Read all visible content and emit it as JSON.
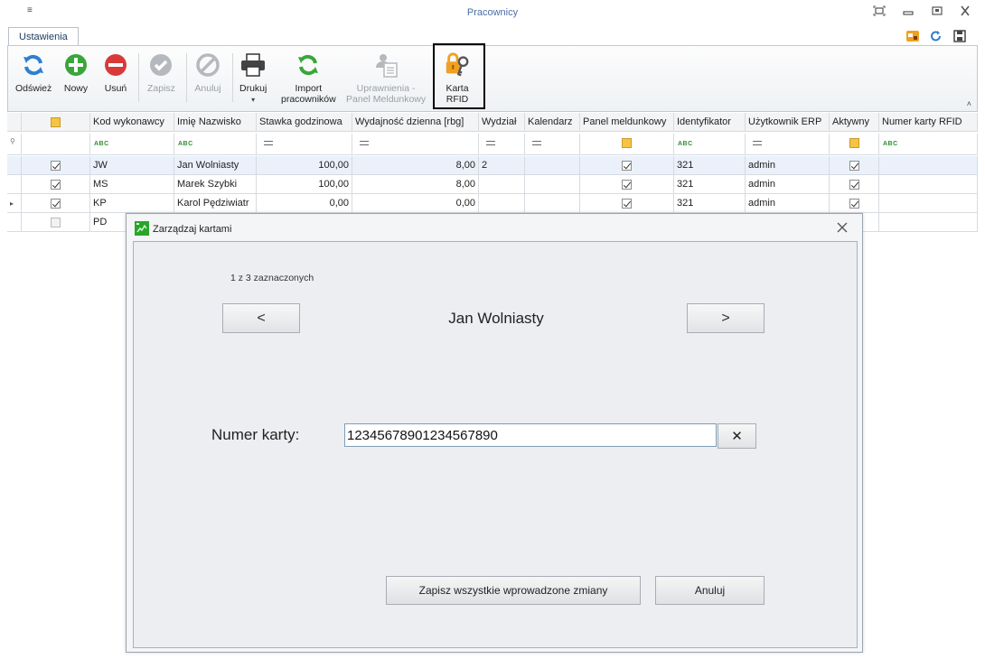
{
  "window": {
    "title": "Pracownicy",
    "qa_glyph": "≡"
  },
  "tabs": [
    {
      "label": "Ustawienia"
    }
  ],
  "ribbon": {
    "buttons": [
      {
        "label": "Odśwież",
        "icon": "refresh-icon",
        "enabled": true
      },
      {
        "label": "Nowy",
        "icon": "add-icon",
        "enabled": true
      },
      {
        "label": "Usuń",
        "icon": "delete-icon",
        "enabled": true
      },
      {
        "label": "Zapisz",
        "icon": "save-check-icon",
        "enabled": false
      },
      {
        "label": "Anuluj",
        "icon": "cancel-icon",
        "enabled": false
      },
      {
        "label": "Drukuj",
        "icon": "printer-icon",
        "enabled": true,
        "dropdown": "▾"
      },
      {
        "label_line1": "Import",
        "label_line2": "pracowników",
        "icon": "import-icon",
        "enabled": true
      },
      {
        "label_line1": "Uprawnienia -",
        "label_line2": "Panel Meldunkowy",
        "icon": "permissions-icon",
        "enabled": false
      },
      {
        "label_line1": "Karta",
        "label_line2": "RFID",
        "icon": "rfid-lock-key-icon",
        "enabled": true
      }
    ],
    "collapse_glyph": "˄"
  },
  "grid": {
    "columns": [
      "",
      "",
      "Kod wykonawcy",
      "Imię Nazwisko",
      "Stawka godzinowa",
      "Wydajność dzienna [rbg]",
      "Wydział",
      "Kalendarz",
      "Panel meldunkowy",
      "Identyfikator",
      "Użytkownik ERP",
      "Aktywny",
      "Numer karty RFID"
    ],
    "filter_abc": "ABC",
    "rows": [
      {
        "indicator": "",
        "checked": true,
        "code": "JW",
        "name": "Jan Wolniasty",
        "rate": "100,00",
        "efficiency": "8,00",
        "department": "2",
        "calendar": "",
        "panel": true,
        "identifier": "321",
        "erp_user": "admin",
        "active": true,
        "rfid": ""
      },
      {
        "indicator": "",
        "checked": true,
        "code": "MS",
        "name": "Marek Szybki",
        "rate": "100,00",
        "efficiency": "8,00",
        "department": "",
        "calendar": "",
        "panel": true,
        "identifier": "321",
        "erp_user": "admin",
        "active": true,
        "rfid": ""
      },
      {
        "indicator": "▸",
        "checked": true,
        "code": "KP",
        "name": "Karol Pędziwiatr",
        "rate": "0,00",
        "efficiency": "0,00",
        "department": "",
        "calendar": "",
        "panel": true,
        "identifier": "321",
        "erp_user": "admin",
        "active": true,
        "rfid": ""
      },
      {
        "indicator": "",
        "checked": false,
        "code": "PD",
        "name": "",
        "rate": "",
        "efficiency": "",
        "department": "",
        "calendar": "",
        "panel": false,
        "identifier": "",
        "erp_user": "",
        "active": false,
        "rfid": ""
      }
    ]
  },
  "dialog": {
    "title": "Zarządzaj kartami",
    "counter": "1 z 3 zaznaczonych",
    "prev_label": "<",
    "next_label": ">",
    "employee_name": "Jan Wolniasty",
    "card_label": "Numer karty:",
    "card_value": "12345678901234567890",
    "clear_label": "✕",
    "save_all_label": "Zapisz wszystkie wprowadzone zmiany",
    "cancel_label": "Anuluj"
  },
  "colors": {
    "accent": "#4a6fa5",
    "refresh": "#2f7fd1",
    "add": "#3aa63a",
    "delete": "#d83a3a",
    "rfid_lock": "#f0a020"
  }
}
